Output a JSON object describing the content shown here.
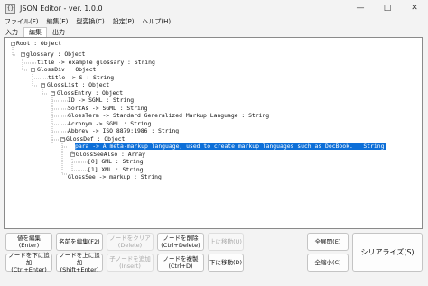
{
  "window": {
    "title": "JSON Editor - ver. 1.0.0",
    "app_icon": "{}"
  },
  "menubar": [
    "ファイル(F)",
    "編集(E)",
    "型変換(C)",
    "設定(P)",
    "ヘルプ(H)"
  ],
  "tabs": [
    "入力",
    "編集",
    "出力"
  ],
  "tree": [
    "Root : Object",
    "glossary : Object",
    "title -> example glossary : String",
    "GlossDiv : Object",
    "title -> S : String",
    "GlossList : Object",
    "GlossEntry : Object",
    "ID -> SGML : String",
    "SortAs -> SGML : String",
    "GlossTerm -> Standard Generalized Markup Language : String",
    "Acronym -> SGML : String",
    "Abbrev -> ISO 8879:1986 : String",
    "GlossDef : Object",
    "para -> A meta-markup language, used to create markup languages such as DocBook. : String",
    "GlossSeeAlso : Array",
    "[0] GML : String",
    "[1] XML : String",
    "GlossSee -> markup : String"
  ],
  "buttons": {
    "edit_value": [
      "値を編集",
      "(Enter)"
    ],
    "edit_name": [
      "名前を編集(F2)"
    ],
    "clear_node": [
      "ノードをクリア",
      "(Delete)"
    ],
    "delete_node": [
      "ノードを削除",
      "(Ctrl+Delete)"
    ],
    "move_up": [
      "上に移動(U)"
    ],
    "expand_all": [
      "全展開(E)"
    ],
    "add_below": [
      "ノードを下に追加",
      "(Ctrl+Enter)"
    ],
    "add_above": [
      "ノードを上に追加",
      "(Shift+Enter)"
    ],
    "add_child": [
      "子ノードを追加",
      "(Insert)"
    ],
    "duplicate": [
      "ノードを複製",
      "(Ctrl+D)"
    ],
    "move_down": [
      "下に移動(D)"
    ],
    "collapse_all": [
      "全縮小(C)"
    ],
    "serialize": [
      "シリアライズ(S)"
    ]
  }
}
